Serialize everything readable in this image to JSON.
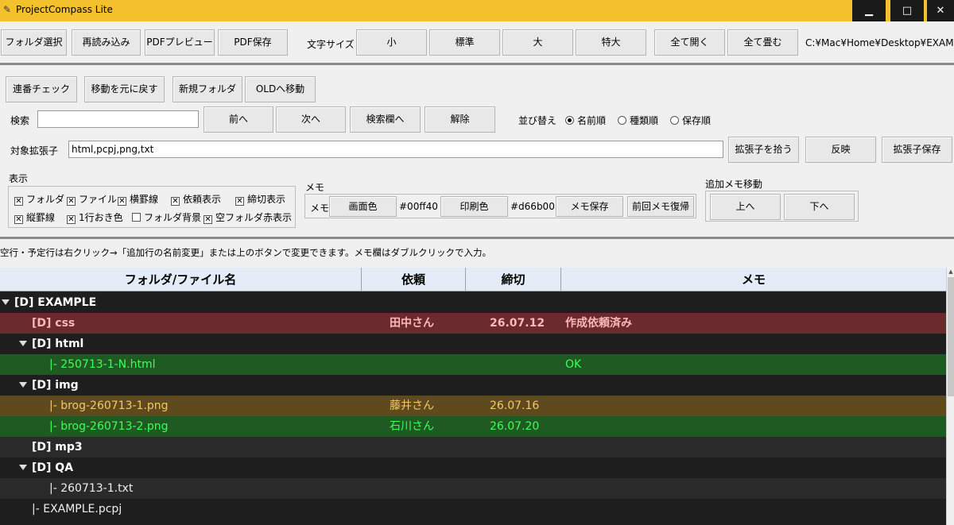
{
  "window": {
    "title": "ProjectCompass Lite",
    "minimize": "▁",
    "maximize": "□",
    "close": "✕"
  },
  "toolbar1": {
    "select_folder": "フォルダ選択",
    "reload": "再読み込み",
    "pdf_preview": "PDFプレビュー",
    "pdf_save": "PDF保存",
    "font_size_label": "文字サイズ",
    "size_small": "小",
    "size_normal": "標準",
    "size_large": "大",
    "size_xlarge": "特大",
    "expand_all": "全て開く",
    "collapse_all": "全て畳む",
    "path": "C:¥Mac¥Home¥Desktop¥EXAMPLE"
  },
  "toolbar2": {
    "serial_check": "連番チェック",
    "undo_move": "移動を元に戻す",
    "new_folder": "新規フォルダ",
    "move_to_old": "OLDへ移動"
  },
  "search": {
    "label": "検索",
    "value": "",
    "prev": "前へ",
    "next": "次へ",
    "to_search_field": "検索欄へ",
    "clear": "解除"
  },
  "sort": {
    "label": "並び替え",
    "options": [
      "名前順",
      "種類順",
      "保存順"
    ],
    "selected": "名前順"
  },
  "extensions": {
    "label": "対象拡張子",
    "value": "html,pcpj,png,txt",
    "pick": "拡張子を拾う",
    "apply": "反映",
    "save": "拡張子保存"
  },
  "display": {
    "label": "表示",
    "options": [
      {
        "label": "フォルダ",
        "checked": true
      },
      {
        "label": "ファイル",
        "checked": true
      },
      {
        "label": "横罫線",
        "checked": true
      },
      {
        "label": "依頼表示",
        "checked": true
      },
      {
        "label": "締切表示",
        "checked": true
      },
      {
        "label": "縦罫線",
        "checked": true
      },
      {
        "label": "1行おき色",
        "checked": true
      },
      {
        "label": "フォルダ背景",
        "checked": false
      },
      {
        "label": "空フォルダ赤表示",
        "checked": true
      }
    ]
  },
  "memo": {
    "label": "メモ",
    "inner_label": "メモ",
    "screen_color": "画面色",
    "screen_color_value": "#00ff40",
    "print_color": "印刷色",
    "print_color_value": "#d66b00",
    "save": "メモ保存",
    "restore": "前回メモ復帰"
  },
  "extra_memo": {
    "label": "追加メモ移動",
    "up": "上へ",
    "down": "下へ"
  },
  "hint": "空行・予定行は右クリック→「追加行の名前変更」または上のボタンで変更できます。メモ欄はダブルクリックで入力。",
  "table": {
    "columns": [
      "フォルダ/ファイル名",
      "依頼",
      "締切",
      "メモ"
    ],
    "rows": [
      {
        "name": "[D] EXAMPLE",
        "request": "",
        "deadline": "",
        "memo": "",
        "indent": 0,
        "twisty": true,
        "bold": true,
        "bg": "#1e1e1e",
        "color": "#ffffff"
      },
      {
        "name": "[D] css",
        "request": "田中さん",
        "deadline": "26.07.12",
        "memo": "作成依頼済み",
        "indent": 1,
        "twisty": false,
        "bold": true,
        "bg": "#6b2a2e",
        "color": "#ffb6b6"
      },
      {
        "name": "[D] html",
        "request": "",
        "deadline": "",
        "memo": "",
        "indent": 1,
        "twisty": true,
        "bold": true,
        "bg": "#1e1e1e",
        "color": "#ffffff"
      },
      {
        "name": "|- 250713-1-N.html",
        "request": "",
        "deadline": "",
        "memo": "OK",
        "indent": 3,
        "twisty": false,
        "bold": false,
        "bg": "#1f5a22",
        "color": "#3dff5a"
      },
      {
        "name": "[D] img",
        "request": "",
        "deadline": "",
        "memo": "",
        "indent": 1,
        "twisty": true,
        "bold": true,
        "bg": "#1e1e1e",
        "color": "#ffffff"
      },
      {
        "name": "|- brog-260713-1.png",
        "request": "藤井さん",
        "deadline": "26.07.16",
        "memo": "",
        "indent": 3,
        "twisty": false,
        "bold": false,
        "bg": "#5e4a1c",
        "color": "#f4c76b"
      },
      {
        "name": "|- brog-260713-2.png",
        "request": "石川さん",
        "deadline": "26.07.20",
        "memo": "",
        "indent": 3,
        "twisty": false,
        "bold": false,
        "bg": "#1f5a22",
        "color": "#3dff5a"
      },
      {
        "name": "[D] mp3",
        "request": "",
        "deadline": "",
        "memo": "",
        "indent": 1,
        "twisty": false,
        "bold": true,
        "bg": "#2a2a2a",
        "color": "#ffffff"
      },
      {
        "name": "[D] QA",
        "request": "",
        "deadline": "",
        "memo": "",
        "indent": 1,
        "twisty": true,
        "bold": true,
        "bg": "#1e1e1e",
        "color": "#ffffff"
      },
      {
        "name": "|- 260713-1.txt",
        "request": "",
        "deadline": "",
        "memo": "",
        "indent": 3,
        "twisty": false,
        "bold": false,
        "bg": "#2a2a2a",
        "color": "#eeeeee"
      },
      {
        "name": "|- EXAMPLE.pcpj",
        "request": "",
        "deadline": "",
        "memo": "",
        "indent": 2,
        "twisty": false,
        "bold": false,
        "bg": "#1e1e1e",
        "color": "#eeeeee"
      }
    ]
  }
}
